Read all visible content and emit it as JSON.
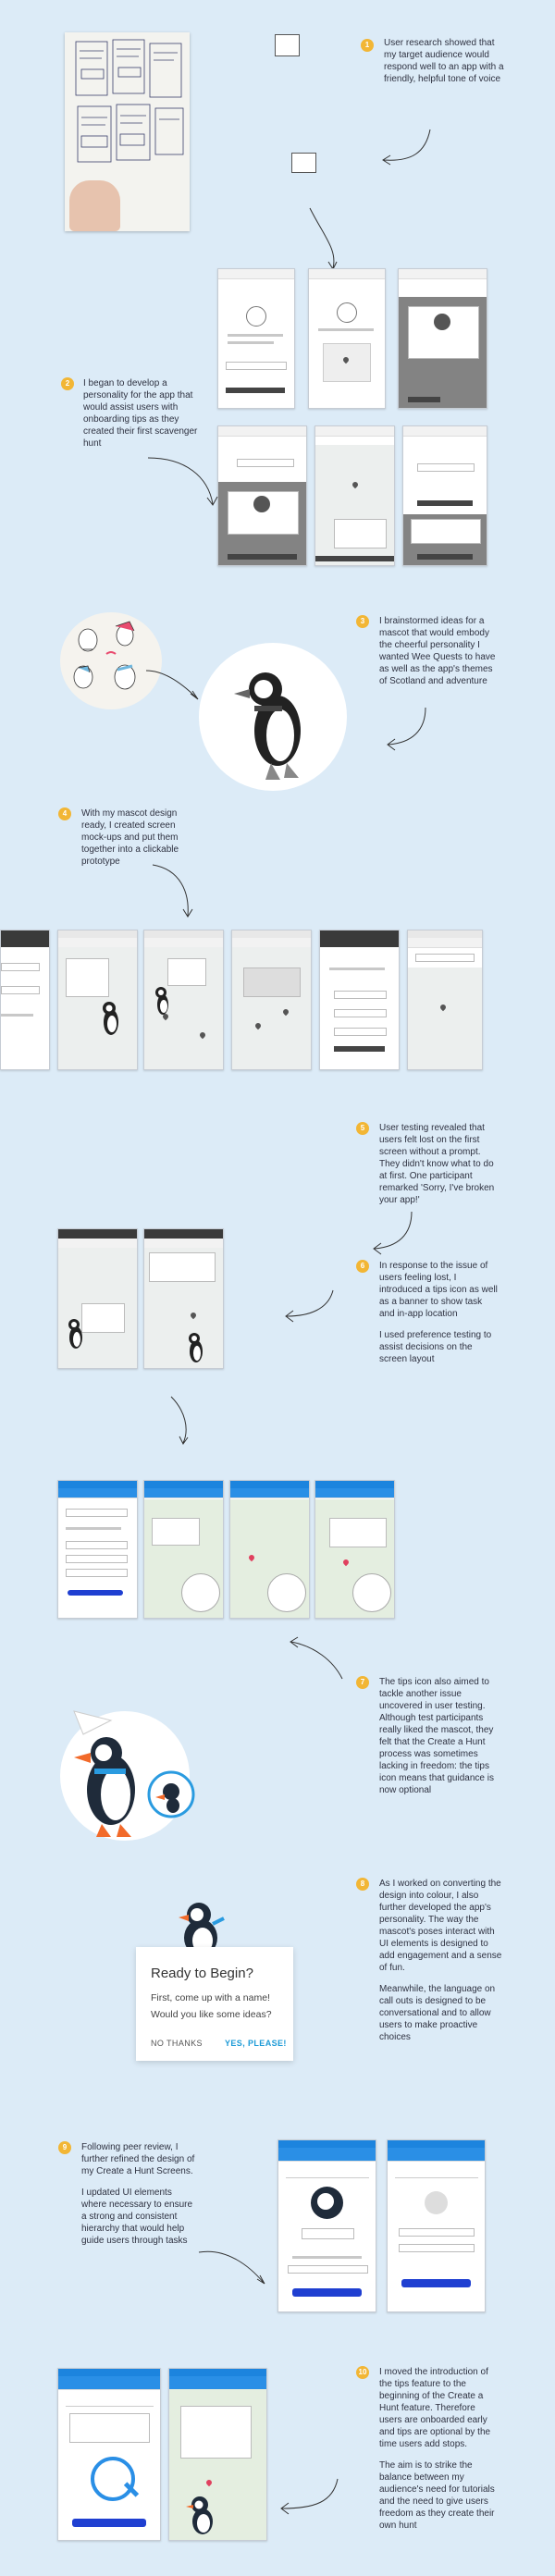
{
  "steps": [
    {
      "num": "1",
      "paragraphs": [
        "User research showed that my target audience would respond well to an app with a friendly, helpful tone of voice"
      ]
    },
    {
      "num": "2",
      "paragraphs": [
        "I began to develop a personality for the app that would assist users with onboarding tips as they created their first scavenger hunt"
      ]
    },
    {
      "num": "3",
      "paragraphs": [
        "I brainstormed ideas for a mascot that would embody the cheerful personality I wanted Wee Quests to have as well as the app's themes of Scotland and adventure"
      ]
    },
    {
      "num": "4",
      "paragraphs": [
        "With my mascot design ready, I created screen mock-ups and put them together into a clickable prototype"
      ]
    },
    {
      "num": "5",
      "paragraphs": [
        "User testing revealed that users felt lost on the first screen without a prompt. They didn't know what to do at first. One participant remarked 'Sorry, I've broken your app!'"
      ]
    },
    {
      "num": "6",
      "paragraphs": [
        "In response to the issue of users feeling lost, I introduced a tips icon as well as a banner to show task and in-app location",
        "I used preference testing to assist decisions on the screen layout"
      ]
    },
    {
      "num": "7",
      "paragraphs": [
        "The tips icon also aimed to tackle another issue uncovered in user testing. Although test participants really liked the mascot, they felt that the Create a Hunt process was sometimes lacking in freedom: the tips icon means that guidance is now optional"
      ]
    },
    {
      "num": "8",
      "paragraphs": [
        "As I worked on converting the design into colour, I also further developed the app's personality. The way the mascot's poses interact with UI elements is designed to add engagement and a sense of fun.",
        "Meanwhile, the language on call outs is designed to be conversational and to allow users to make proactive choices"
      ]
    },
    {
      "num": "9",
      "paragraphs": [
        "Following peer review, I further refined the design of my Create a Hunt Screens.",
        "I updated UI elements where necessary to ensure a strong and consistent hierarchy that would help guide users through tasks"
      ]
    },
    {
      "num": "10",
      "paragraphs": [
        "I moved the introduction of the tips feature to the beginning of the Create a Hunt feature. Therefore users are onboarded early and tips are optional by the time users add stops.",
        "The aim is to strike the balance between my audience's need for tutorials and the need to give users freedom as they create their own hunt"
      ]
    }
  ],
  "dialog": {
    "title": "Ready to Begin?",
    "body": "First, come up with a name! Would you like some ideas?",
    "no_label": "NO THANKS",
    "yes_label": "YES, PLEASE!"
  },
  "colors": {
    "background": "#dcebf7",
    "badge": "#f2b635",
    "accent_blue": "#1c84de",
    "dialog_yes": "#1c9ad6"
  }
}
